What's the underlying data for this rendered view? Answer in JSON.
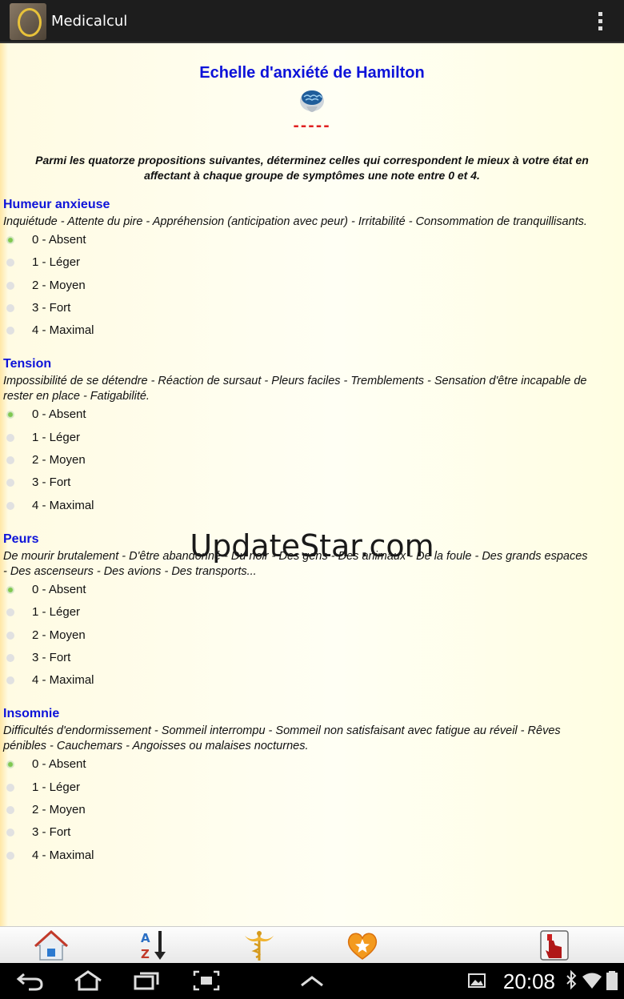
{
  "app": {
    "title": "Medicalcul"
  },
  "page": {
    "title": "Echelle d'anxiété de Hamilton",
    "dashes": "-----",
    "intro": "Parmi les quatorze propositions suivantes, déterminez celles qui correspondent le mieux à votre état en affectant à chaque groupe de symptômes une note entre 0 et 4."
  },
  "options": [
    "0 - Absent",
    "1 - Léger",
    "2 - Moyen",
    "3 - Fort",
    "4 - Maximal"
  ],
  "sections": [
    {
      "title": "Humeur anxieuse",
      "description": "Inquiétude - Attente du pire - Appréhension (anticipation avec peur) - Irritabilité - Consommation de tranquillisants.",
      "selected": 0
    },
    {
      "title": "Tension",
      "description": "Impossibilité de se détendre - Réaction de sursaut - Pleurs faciles - Tremblements - Sensation d'être incapable de rester en place - Fatigabilité.",
      "selected": 0
    },
    {
      "title": "Peurs",
      "description": "De mourir brutalement - D'être abandonné - Du noir - Des gens - Des animaux - De la foule - Des grands espaces - Des ascenseurs - Des avions - Des transports...",
      "selected": 0
    },
    {
      "title": "Insomnie",
      "description": "Difficultés d'endormissement - Sommeil interrompu - Sommeil non satisfaisant avec fatigue au réveil - Rêves pénibles - Cauchemars - Angoisses ou malaises nocturnes.",
      "selected": 0
    }
  ],
  "watermark": "UpdateStar.com",
  "toolbar": {
    "icons": [
      "home-icon",
      "sort-az-icon",
      "caduceus-icon",
      "favorite-heart-icon",
      "touch-icon"
    ],
    "sort_letters": "AZ"
  },
  "status": {
    "time": "20:08"
  },
  "colors": {
    "accent": "#0d13d9",
    "dashes": "#e02020",
    "radio_checked": "#7ec850"
  }
}
